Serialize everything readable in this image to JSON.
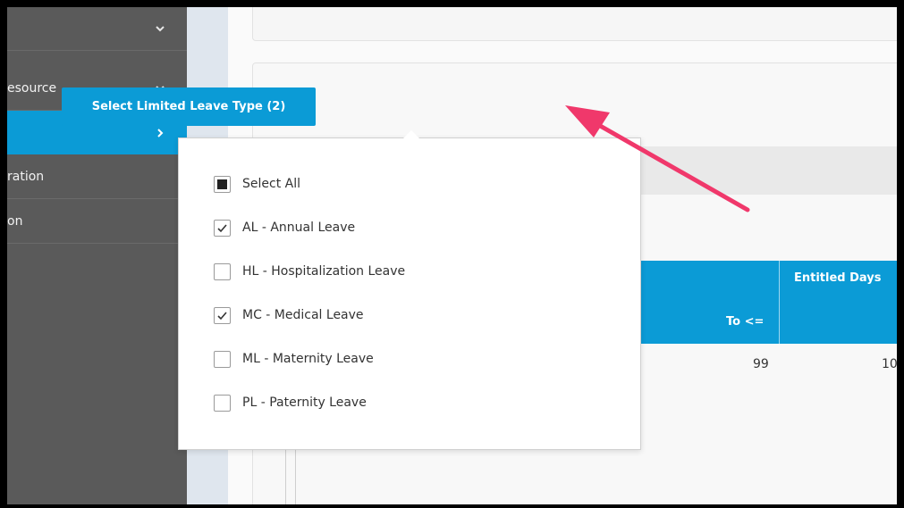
{
  "sidebar": {
    "items": [
      {
        "label": "",
        "chevron": "chevron-down-icon"
      },
      {
        "label": "esource",
        "chevron": "chevron-down-icon"
      },
      {
        "label": "",
        "chevron": "chevron-right-icon",
        "active": true
      },
      {
        "label": "ration"
      },
      {
        "label": "on"
      }
    ]
  },
  "main": {
    "select_button_label": "Select Limited Leave Type (2)",
    "table": {
      "headers": {
        "to": "To <=",
        "entitled": "Entitled Days"
      },
      "row": {
        "to": "99",
        "entitled": "10"
      }
    }
  },
  "dropdown": {
    "select_all_label": "Select All",
    "options": [
      {
        "label": "AL - Annual Leave",
        "checked": true
      },
      {
        "label": "HL - Hospitalization Leave",
        "checked": false
      },
      {
        "label": "MC - Medical Leave",
        "checked": true
      },
      {
        "label": "ML - Maternity Leave",
        "checked": false
      },
      {
        "label": "PL - Paternity Leave",
        "checked": false
      }
    ]
  },
  "colors": {
    "accent": "#0b9bd6",
    "sidebar": "#5a5a5a",
    "annotation_arrow": "#f0386b"
  }
}
